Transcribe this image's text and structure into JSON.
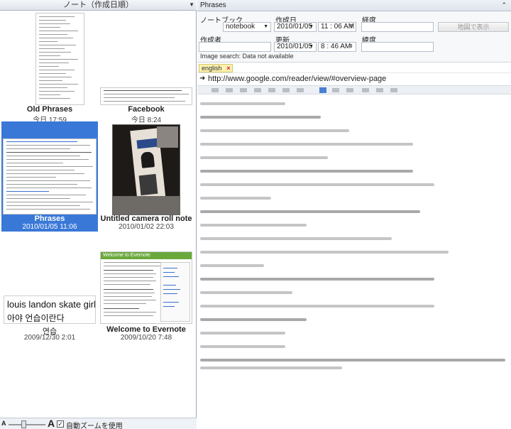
{
  "note_list": {
    "sort_label": "ノート（作成日順）",
    "notes": [
      {
        "title": "Old Phrases",
        "date": "今日 17:59"
      },
      {
        "title": "Facebook",
        "date": "今日 8:24"
      },
      {
        "title": "Phrases",
        "date": "2010/01/05 11:06"
      },
      {
        "title": "Untitled camera roll note",
        "date": "2010/01/02 22:03"
      },
      {
        "title": "연습",
        "date": "2009/12/30 2:01",
        "preview_line1": "louis landon skate girl",
        "preview_line2": "아야 언습이란다"
      },
      {
        "title": "Welcome to Evernote",
        "date": "2009/10/20 7:48",
        "preview_heading": "Welcome to Evernote"
      }
    ]
  },
  "zoom": {
    "small_a": "A",
    "big_a": "A",
    "checkbox_mark": "✓",
    "auto_zoom_label": "自動ズームを使用",
    "auto_zoom_checked": true
  },
  "note_panel": {
    "title": "Phrases",
    "props": {
      "notebook_label": "ノートブック",
      "notebook_value": "notebook",
      "created_label": "作成日",
      "created_date": "2010/01/05",
      "created_time": "11 : 06   AM",
      "longitude_label": "経度",
      "map_button": "地図で表示",
      "author_label": "作成者",
      "updated_label": "更新",
      "updated_date": "2010/01/05",
      "updated_time": "8 : 46   AM",
      "latitude_label": "緯度",
      "image_search": "Image search: Data not available"
    },
    "tags": [
      "english"
    ],
    "source_url": "http://www.google.com/reader/view/#overview-page"
  },
  "colors": {
    "selection": "#3a78d8",
    "tag_bg": "#fbf1b0",
    "header_bg": "#dfe4ea"
  }
}
